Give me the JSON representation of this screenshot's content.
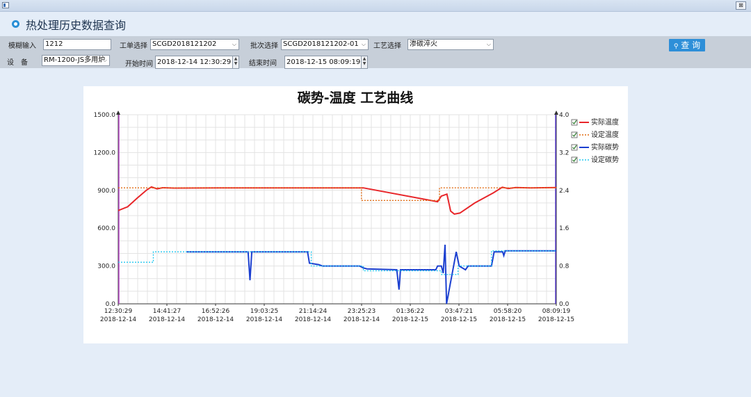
{
  "window": {
    "close_glyph": "⊠"
  },
  "header": {
    "title": "热处理历史数据查询"
  },
  "filters": {
    "fuzzy_label": "模糊输入",
    "fuzzy_value": "1212",
    "work_order_label": "工单选择",
    "work_order_value": "SCGD2018121202",
    "batch_label": "批次选择",
    "batch_value": "SCGD2018121202-01",
    "process_label": "工艺选择",
    "process_value": "渗碳淬火",
    "device_label": "设　备",
    "device_value": "RM-1200-JS多用炉",
    "start_label": "开始时间",
    "start_value": "2018-12-14 12:30:29",
    "end_label": "结束时间",
    "end_value": "2018-12-15 08:09:19",
    "query_label": "查 询",
    "query_icon": "search-icon"
  },
  "chart_data": {
    "type": "line",
    "title": "碳势-温度 工艺曲线",
    "x_ticks": [
      {
        "time": "12:30:29",
        "date": "2018-12-14"
      },
      {
        "time": "14:41:27",
        "date": "2018-12-14"
      },
      {
        "time": "16:52:26",
        "date": "2018-12-14"
      },
      {
        "time": "19:03:25",
        "date": "2018-12-14"
      },
      {
        "time": "21:14:24",
        "date": "2018-12-14"
      },
      {
        "time": "23:25:23",
        "date": "2018-12-14"
      },
      {
        "time": "01:36:22",
        "date": "2018-12-15"
      },
      {
        "time": "03:47:21",
        "date": "2018-12-15"
      },
      {
        "time": "05:58:20",
        "date": "2018-12-15"
      },
      {
        "time": "08:09:19",
        "date": "2018-12-15"
      }
    ],
    "x_range": [
      "2018-12-14 12:30:29",
      "2018-12-15 08:09:19"
    ],
    "y_left": {
      "ticks": [
        "0.0",
        "300.0",
        "600.0",
        "900.0",
        "1200.0",
        "1500.0"
      ],
      "range": [
        0,
        1500
      ]
    },
    "y_right": {
      "ticks": [
        "0.0",
        "0.8",
        "1.6",
        "2.4",
        "3.2",
        "4.0"
      ],
      "range": [
        0,
        4.0
      ]
    },
    "grid": true,
    "legend_position": "right",
    "series": [
      {
        "name": "实际温度",
        "axis": "left",
        "color": "#e8262a",
        "dash": "",
        "checked": true,
        "points": [
          [
            "2018-12-14 12:30:29",
            740
          ],
          [
            "2018-12-14 12:56:00",
            770
          ],
          [
            "2018-12-14 13:22:00",
            840
          ],
          [
            "2018-12-14 13:48:00",
            905
          ],
          [
            "2018-12-14 14:00:00",
            927
          ],
          [
            "2018-12-14 14:15:00",
            912
          ],
          [
            "2018-12-14 14:30:00",
            921
          ],
          [
            "2018-12-14 15:00:00",
            918
          ],
          [
            "2018-12-14 17:00:00",
            920
          ],
          [
            "2018-12-14 21:00:00",
            920
          ],
          [
            "2018-12-14 23:30:00",
            920
          ],
          [
            "2018-12-15 02:50:00",
            810
          ],
          [
            "2018-12-15 03:00:00",
            855
          ],
          [
            "2018-12-15 03:15:00",
            870
          ],
          [
            "2018-12-15 03:25:00",
            735
          ],
          [
            "2018-12-15 03:35:00",
            712
          ],
          [
            "2018-12-15 03:50:00",
            720
          ],
          [
            "2018-12-15 04:30:00",
            800
          ],
          [
            "2018-12-15 05:20:00",
            880
          ],
          [
            "2018-12-15 05:44:00",
            925
          ],
          [
            "2018-12-15 06:00:00",
            915
          ],
          [
            "2018-12-15 06:20:00",
            922
          ],
          [
            "2018-12-15 07:00:00",
            920
          ],
          [
            "2018-12-15 08:09:19",
            922
          ]
        ]
      },
      {
        "name": "设定温度",
        "axis": "left",
        "color": "#e06a10",
        "dash": "2,2",
        "checked": true,
        "points": [
          [
            "2018-12-14 12:30:29",
            920
          ],
          [
            "2018-12-14 23:25:00",
            920
          ],
          [
            "2018-12-14 23:25:00",
            820
          ],
          [
            "2018-12-15 02:55:00",
            820
          ],
          [
            "2018-12-15 02:55:00",
            920
          ],
          [
            "2018-12-15 08:09:19",
            920
          ]
        ]
      },
      {
        "name": "实际碳势",
        "axis": "right",
        "color": "#1b3fd0",
        "dash": "",
        "checked": true,
        "points": [
          [
            "2018-12-14 15:35:00",
            1.1
          ],
          [
            "2018-12-14 18:20:00",
            1.1
          ],
          [
            "2018-12-14 18:25:00",
            0.5
          ],
          [
            "2018-12-14 18:30:00",
            1.1
          ],
          [
            "2018-12-14 21:00:00",
            1.1
          ],
          [
            "2018-12-14 21:05:00",
            0.86
          ],
          [
            "2018-12-14 21:30:00",
            0.83
          ],
          [
            "2018-12-14 21:40:00",
            0.8
          ],
          [
            "2018-12-14 23:20:00",
            0.8
          ],
          [
            "2018-12-14 23:30:00",
            0.76
          ],
          [
            "2018-12-14 23:40:00",
            0.74
          ],
          [
            "2018-12-15 01:00:00",
            0.72
          ],
          [
            "2018-12-15 01:06:00",
            0.3
          ],
          [
            "2018-12-15 01:10:00",
            0.72
          ],
          [
            "2018-12-15 02:45:00",
            0.72
          ],
          [
            "2018-12-15 02:50:00",
            0.8
          ],
          [
            "2018-12-15 03:00:00",
            0.8
          ],
          [
            "2018-12-15 03:05:00",
            0.65
          ],
          [
            "2018-12-15 03:10:00",
            1.25
          ],
          [
            "2018-12-15 03:14:00",
            0.0
          ],
          [
            "2018-12-15 03:40:00",
            1.1
          ],
          [
            "2018-12-15 03:48:00",
            0.8
          ],
          [
            "2018-12-15 04:05:00",
            0.72
          ],
          [
            "2018-12-15 04:12:00",
            0.8
          ],
          [
            "2018-12-15 05:00:00",
            0.8
          ],
          [
            "2018-12-15 05:15:00",
            0.8
          ],
          [
            "2018-12-15 05:22:00",
            1.1
          ],
          [
            "2018-12-15 05:45:00",
            1.1
          ],
          [
            "2018-12-15 05:48:00",
            1.02
          ],
          [
            "2018-12-15 05:52:00",
            1.12
          ],
          [
            "2018-12-15 08:09:19",
            1.12
          ]
        ]
      },
      {
        "name": "设定碳势",
        "axis": "right",
        "color": "#20c8f0",
        "dash": "2,2",
        "checked": true,
        "points": [
          [
            "2018-12-14 12:30:29",
            0.88
          ],
          [
            "2018-12-14 14:05:00",
            0.88
          ],
          [
            "2018-12-14 14:05:00",
            1.1
          ],
          [
            "2018-12-14 21:10:00",
            1.1
          ],
          [
            "2018-12-14 21:10:00",
            0.8
          ],
          [
            "2018-12-14 23:30:00",
            0.8
          ],
          [
            "2018-12-14 23:30:00",
            0.7
          ],
          [
            "2018-12-15 03:00:00",
            0.7
          ],
          [
            "2018-12-15 03:00:00",
            0.62
          ],
          [
            "2018-12-15 03:45:00",
            0.62
          ],
          [
            "2018-12-15 03:45:00",
            0.8
          ],
          [
            "2018-12-15 05:15:00",
            0.8
          ],
          [
            "2018-12-15 05:15:00",
            1.12
          ],
          [
            "2018-12-15 08:09:19",
            1.12
          ]
        ]
      }
    ]
  }
}
